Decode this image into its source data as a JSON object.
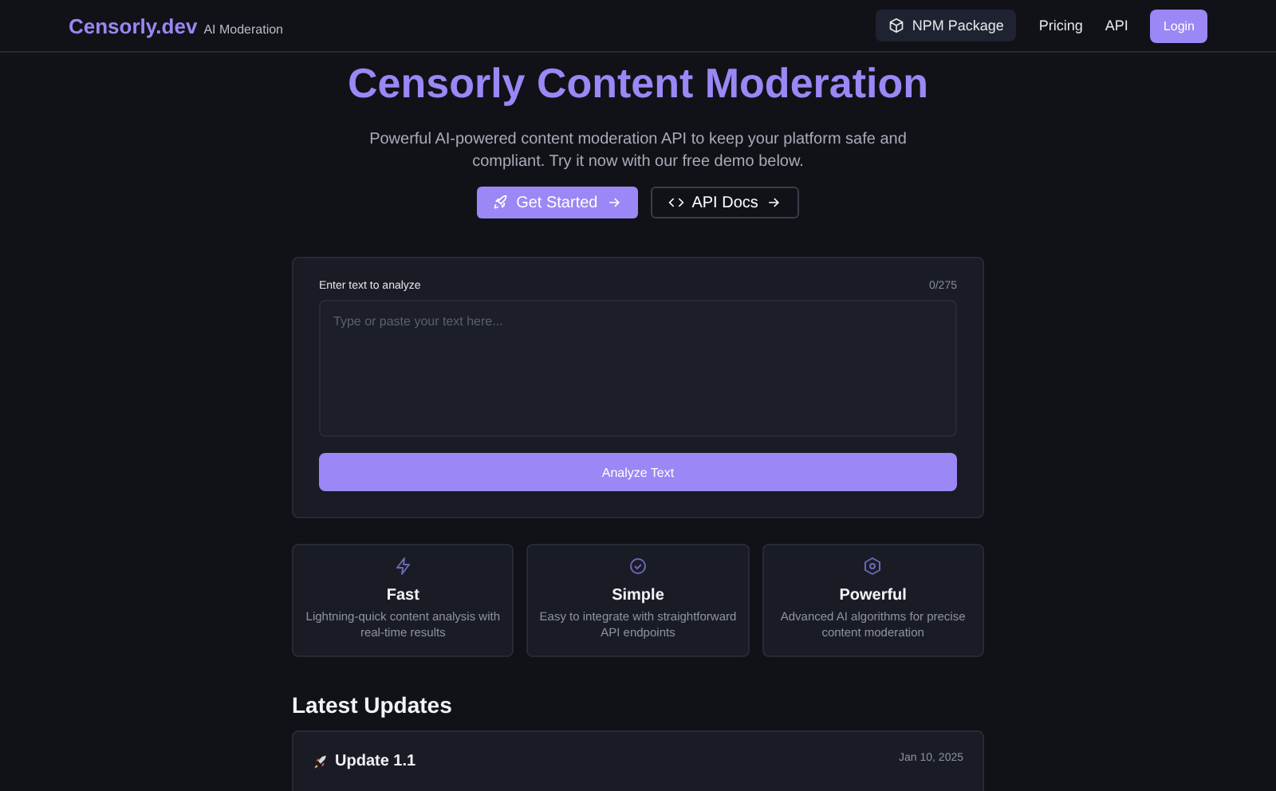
{
  "nav": {
    "brand": "Censorly.dev",
    "tagline": "AI Moderation",
    "links": [
      {
        "label": "NPM Package",
        "kind": "package"
      },
      {
        "label": "Pricing",
        "kind": "link"
      },
      {
        "label": "API",
        "kind": "link"
      }
    ],
    "login": "Login"
  },
  "hero": {
    "title": "Censorly Content Moderation",
    "subtitle": "Powerful AI-powered content moderation API to keep your platform safe and compliant. Try it now with our free demo below.",
    "primary": "Get Started",
    "secondary": "API Docs"
  },
  "demo": {
    "label": "Enter text to analyze",
    "counter": "0/275",
    "placeholder": "Type or paste your text here...",
    "button": "Analyze Text"
  },
  "features": [
    {
      "kind": "bolt",
      "title": "Fast",
      "text": "Lightning-quick content analysis with real-time results"
    },
    {
      "kind": "check",
      "title": "Simple",
      "text": "Easy to integrate with straightforward API endpoints"
    },
    {
      "kind": "gear",
      "title": "Powerful",
      "text": "Advanced AI algorithms for precise content moderation"
    }
  ],
  "updates": {
    "heading": "Latest Updates",
    "items": [
      {
        "title": "Update 1.1",
        "date": "Jan 10, 2025"
      }
    ]
  }
}
